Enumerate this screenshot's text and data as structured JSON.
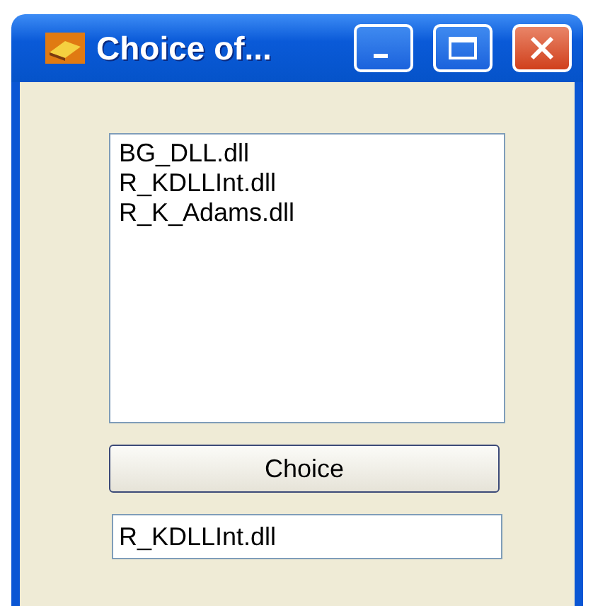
{
  "window": {
    "title": "Choice of..."
  },
  "list": {
    "items": [
      {
        "label": "BG_DLL.dll"
      },
      {
        "label": "R_KDLLInt.dll"
      },
      {
        "label": "R_K_Adams.dll"
      }
    ]
  },
  "button": {
    "label": "Choice"
  },
  "field": {
    "value": "R_KDLLInt.dll"
  }
}
